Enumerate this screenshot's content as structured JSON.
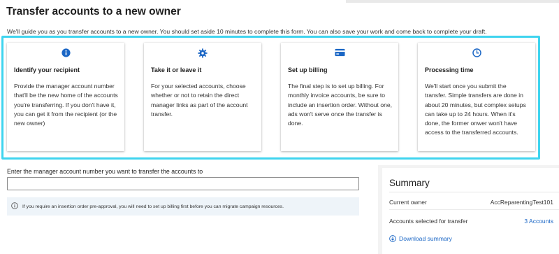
{
  "page": {
    "title": "Transfer accounts to a new owner",
    "intro": "We'll guide you as you transfer accounts to a new owner. You should set aside 10 minutes to complete this form. You can also save your work and come back to complete your draft."
  },
  "cards": [
    {
      "icon": "info-icon",
      "title": "Identify your recipient",
      "body": "Provide the manager account number that'll be the new home of the accounts you're transferring. If you don't have it, you can get it from the recipient (or the new owner)"
    },
    {
      "icon": "gear-icon",
      "title": "Take it or leave it",
      "body": "For your selected accounts, choose whether or not to retain the direct manager links as part of the account transfer."
    },
    {
      "icon": "credit-card-icon",
      "title": "Set up billing",
      "body": "The final step is to set up billing. For monthly invoice accounts, be sure to include an insertion order. Without one, ads won't serve once the transfer is done."
    },
    {
      "icon": "clock-icon",
      "title": "Processing time",
      "body": "We'll start once you submit the transfer. Simple transfers are done in about 20 minutes, but complex setups can take up to 24 hours. When it's done, the former onwer won't have access to the transferred accounts."
    }
  ],
  "form": {
    "account_number_label": "Enter the manager account number you want to transfer the accounts to",
    "account_number_value": "",
    "info_message": "If you require an insertion order pre-approval, you will need to set up billing first before you can migrate campaign resources."
  },
  "summary": {
    "title": "Summary",
    "current_owner_label": "Current owner",
    "current_owner_value": "AccReparentingTest101",
    "accounts_selected_label": "Accounts selected for transfer",
    "accounts_selected_value": "3 Accounts",
    "download_label": "Download summary"
  },
  "colors": {
    "accent": "#1a66c5",
    "highlight_frame": "#3fd4ef",
    "info_background": "#eef4f9"
  }
}
